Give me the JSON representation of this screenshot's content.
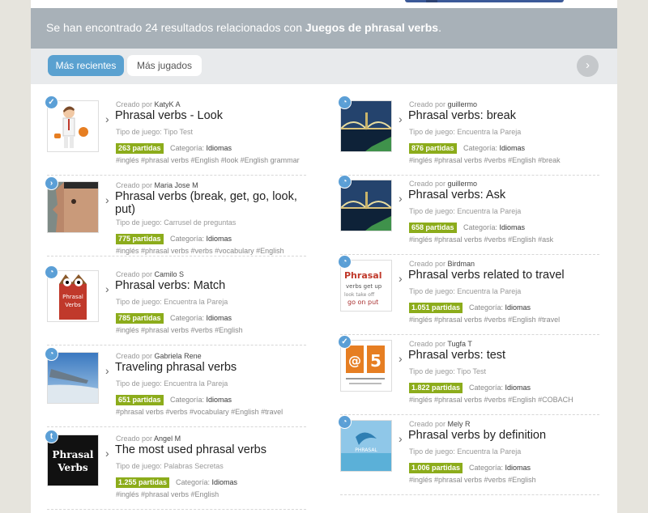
{
  "banner": {
    "prefix": "Se han encontrado 24 resultados relacionados con ",
    "query": "Juegos de phrasal verbs",
    "suffix": "."
  },
  "tabs": [
    {
      "label": "Más recientes",
      "active": true
    },
    {
      "label": "Más jugados",
      "active": false
    }
  ],
  "next_icon": "›",
  "labels": {
    "created_by": "Creado por",
    "game_type": "Tipo de juego:",
    "category": "Categoría:"
  },
  "games": [
    {
      "author": "KatyK A",
      "title": "Phrasal verbs - Look",
      "type": "Tipo Test",
      "plays": "263 partidas",
      "category": "Idiomas",
      "tags": "#inglés   #phrasal verbs   #English   #look   #English grammar",
      "badge": "✓",
      "thumb": "man-looking"
    },
    {
      "author": "Maria Jose M",
      "title": "Phrasal verbs (break, get, go, look, put)",
      "type": "Carrusel de preguntas",
      "plays": "775 partidas",
      "category": "Idiomas",
      "tags": "#inglés   #phrasal verbs   #verbs   #vocabulary   #English",
      "badge": "›",
      "thumb": "face-profile"
    },
    {
      "author": "Camilo S",
      "title": "Phrasal verbs: Match",
      "type": "Encuentra la Pareja",
      "plays": "785 partidas",
      "category": "Idiomas",
      "tags": "#inglés   #phrasal verbs   #verbs   #English",
      "badge": "◔",
      "thumb": "owl-book"
    },
    {
      "author": "Gabriela Rene",
      "title": "Traveling phrasal verbs",
      "type": "Encuentra la Pareja",
      "plays": "651 partidas",
      "category": "Idiomas",
      "tags": "#phrasal verbs   #verbs   #vocabulary   #English   #travel",
      "badge": "◔",
      "thumb": "airplane-wing"
    },
    {
      "author": "Angel M",
      "title": "The most used phrasal verbs",
      "type": "Palabras Secretas",
      "plays": "1.255 partidas",
      "category": "Idiomas",
      "tags": "#inglés   #phrasal verbs   #English",
      "badge": "t",
      "thumb": "phrasal-verbs-text"
    },
    {
      "author": "guillermo",
      "title": "Phrasal verbs: break",
      "type": "Encuentra la Pareja",
      "plays": "876 partidas",
      "category": "Idiomas",
      "tags": "#inglés   #phrasal verbs   #verbs   #English   #break",
      "badge": "◔",
      "thumb": "bridge-night"
    },
    {
      "author": "guillermo",
      "title": "Phrasal verbs: Ask",
      "type": "Encuentra la Pareja",
      "plays": "658 partidas",
      "category": "Idiomas",
      "tags": "#inglés   #phrasal verbs   #verbs   #English   #ask",
      "badge": "◔",
      "thumb": "bridge-night"
    },
    {
      "author": "Birdman",
      "title": "Phrasal verbs related to travel",
      "type": "Encuentra la Pareja",
      "plays": "1.051 partidas",
      "category": "Idiomas",
      "tags": "#inglés   #phrasal verbs   #verbs   #English   #travel",
      "badge": "◔",
      "thumb": "word-cloud"
    },
    {
      "author": "Tugfa T",
      "title": "Phrasal verbs: test",
      "type": "Tipo Test",
      "plays": "1.822 partidas",
      "category": "Idiomas",
      "tags": "#inglés   #phrasal verbs   #verbs   #English   #COBACH",
      "badge": "✓",
      "thumb": "school-logo"
    },
    {
      "author": "Mely R",
      "title": "Phrasal verbs by definition",
      "type": "Encuentra la Pareja",
      "plays": "1.006 partidas",
      "category": "Idiomas",
      "tags": "#inglés   #phrasal verbs   #verbs   #English",
      "badge": "◔",
      "thumb": "bird-picture"
    }
  ]
}
